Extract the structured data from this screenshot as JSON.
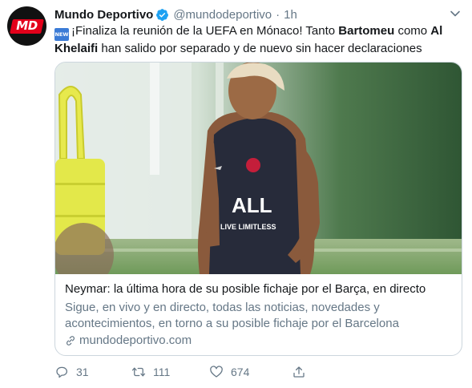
{
  "account": {
    "display_name": "Mundo Deportivo",
    "handle": "@mundodeportivo",
    "separator": "·",
    "time": "1h",
    "avatar_text": "MD"
  },
  "tweet": {
    "badge": "NEW",
    "text_parts": [
      {
        "text": "¡Finaliza la reunión de la UEFA en Mónaco! Tanto ",
        "bold": false
      },
      {
        "text": "Bartomeu",
        "bold": true
      },
      {
        "text": " como ",
        "bold": false
      },
      {
        "text": "Al Khelaifi",
        "bold": true
      },
      {
        "text": " han salido por separado y de nuevo sin hacer declaraciones",
        "bold": false
      }
    ]
  },
  "card": {
    "image_alt": "Neymar entrenando con la camiseta del PSG",
    "jersey_brand": "ALL",
    "jersey_slogan": "LIVE LIMITLESS",
    "title": "Neymar: la última hora de su posible fichaje por el Barça, en directo",
    "description": "Sigue, en vivo y en directo, todas las noticias, novedades y acontecimientos, en torno a su posible fichaje por el Barcelona",
    "domain": "mundodeportivo.com"
  },
  "actions": {
    "replies": "31",
    "retweets": "111",
    "likes": "674"
  },
  "colors": {
    "secondary_text": "#657786",
    "verified": "#1da1f2",
    "border": "#ccd6dd",
    "brand_red": "#e3001b"
  },
  "icons": [
    "verified-icon",
    "caret-down-icon",
    "link-icon",
    "reply-icon",
    "retweet-icon",
    "like-icon",
    "share-icon"
  ]
}
